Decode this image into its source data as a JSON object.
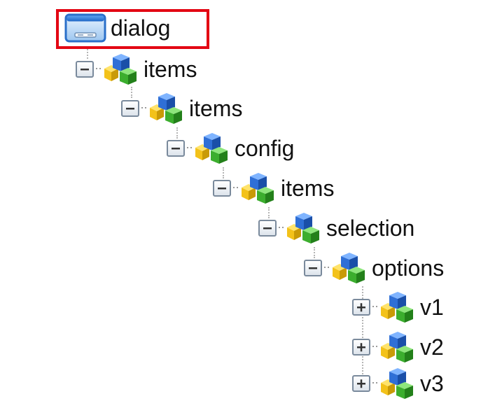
{
  "tree": {
    "root": {
      "label": "dialog",
      "icon": "dialog-window-icon",
      "selected": true
    },
    "nodes": [
      {
        "label": "items",
        "icon": "node-cubes-icon",
        "toggle": "collapse"
      },
      {
        "label": "items",
        "icon": "node-cubes-icon",
        "toggle": "collapse"
      },
      {
        "label": "config",
        "icon": "node-cubes-icon",
        "toggle": "collapse"
      },
      {
        "label": "items",
        "icon": "node-cubes-icon",
        "toggle": "collapse"
      },
      {
        "label": "selection",
        "icon": "node-cubes-icon",
        "toggle": "collapse"
      },
      {
        "label": "options",
        "icon": "node-cubes-icon",
        "toggle": "collapse"
      },
      {
        "label": "v1",
        "icon": "node-cubes-icon",
        "toggle": "expand"
      },
      {
        "label": "v2",
        "icon": "node-cubes-icon",
        "toggle": "expand"
      },
      {
        "label": "v3",
        "icon": "node-cubes-icon",
        "toggle": "expand"
      }
    ]
  },
  "colors": {
    "highlight": "#e30613",
    "cube_blue": "#2f6fd6",
    "cube_yellow": "#f3c21a",
    "cube_green": "#3cae2e",
    "toggle_border": "#7a8a9c"
  }
}
